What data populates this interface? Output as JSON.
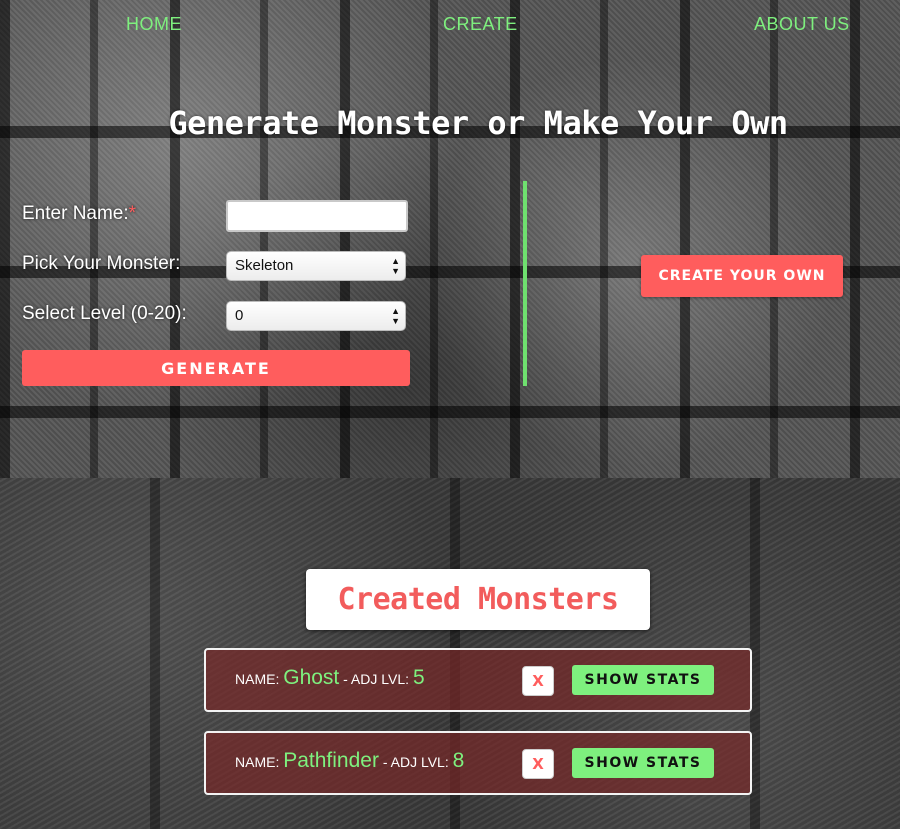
{
  "nav": {
    "home": "HOME",
    "create": "CREATE",
    "about": "ABOUT US"
  },
  "page_title": "Generate Monster or Make Your Own",
  "form": {
    "name_label": "Enter Name:",
    "required_mark": "*",
    "name_value": "",
    "monster_label": "Pick Your Monster:",
    "monster_selected": "Skeleton",
    "level_label": "Select Level (0-20):",
    "level_selected": "0",
    "generate_label": "GENERATE"
  },
  "create_own_label": "CREATE YOUR OWN",
  "created": {
    "title": "Created Monsters",
    "name_prefix": "NAME:",
    "lvl_prefix": "- ADJ LVL:",
    "delete_label": "X",
    "stats_label": "SHOW STATS",
    "monsters": [
      {
        "name": "Ghost",
        "level": "5"
      },
      {
        "name": "Pathfinder",
        "level": "8"
      }
    ]
  },
  "colors": {
    "accent_green": "#7ef07e",
    "accent_red": "#ff5d5d"
  }
}
